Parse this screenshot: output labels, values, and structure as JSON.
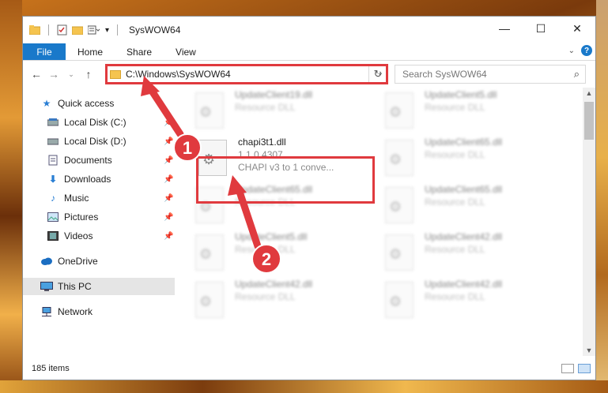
{
  "window": {
    "title": "SysWOW64",
    "controls": {
      "minimize": "—",
      "maximize": "☐",
      "close": "✕"
    }
  },
  "ribbon": {
    "tabs": [
      {
        "label": "File"
      },
      {
        "label": "Home"
      },
      {
        "label": "Share"
      },
      {
        "label": "View"
      }
    ],
    "help": "?"
  },
  "address": {
    "path": "C:\\Windows\\SysWOW64",
    "search_placeholder": "Search SysWOW64"
  },
  "sidebar": {
    "items": [
      {
        "label": "Quick access",
        "icon": "star-icon",
        "pinned": false
      },
      {
        "label": "Local Disk (C:)",
        "icon": "drive-icon",
        "pinned": true
      },
      {
        "label": "Local Disk (D:)",
        "icon": "drive-icon",
        "pinned": true
      },
      {
        "label": "Documents",
        "icon": "documents-icon",
        "pinned": true
      },
      {
        "label": "Downloads",
        "icon": "download-icon",
        "pinned": true
      },
      {
        "label": "Music",
        "icon": "music-icon",
        "pinned": true
      },
      {
        "label": "Pictures",
        "icon": "pictures-icon",
        "pinned": true
      },
      {
        "label": "Videos",
        "icon": "videos-icon",
        "pinned": true
      },
      {
        "label": "OneDrive",
        "icon": "cloud-icon",
        "pinned": false
      },
      {
        "label": "This PC",
        "icon": "computer-icon",
        "pinned": false,
        "selected": true
      },
      {
        "label": "Network",
        "icon": "network-icon",
        "pinned": false
      }
    ]
  },
  "files": {
    "left_column": [
      {
        "name": "UpdateClient19.dll",
        "line2": "Resource DLL",
        "blurred": true
      },
      {
        "name": "chapi3t1.dll",
        "line2": "1.1.0.4307",
        "line3": "CHAPI v3 to 1 conve...",
        "blurred": false
      },
      {
        "name": "UpdateClient65.dll",
        "line2": "Resource DLL",
        "blurred": true
      },
      {
        "name": "UpdateClient5.dll",
        "line2": "Resource DLL",
        "blurred": true
      },
      {
        "name": "UpdateClient42.dll",
        "line2": "Resource DLL",
        "blurred": true
      }
    ],
    "right_column": [
      {
        "name": "UpdateClient5.dll",
        "line2": "Resource DLL",
        "blurred": true
      },
      {
        "name": "UpdateClient65.dll",
        "line2": "Resource DLL",
        "blurred": true
      },
      {
        "name": "UpdateClient65.dll",
        "line2": "Resource DLL",
        "blurred": true
      },
      {
        "name": "UpdateClient42.dll",
        "line2": "Resource DLL",
        "blurred": true
      },
      {
        "name": "UpdateClient42.dll",
        "line2": "Resource DLL",
        "blurred": true
      }
    ]
  },
  "status": {
    "item_count": "185 items"
  },
  "annotations": {
    "marker1": "1",
    "marker2": "2",
    "color": "#e03a3e"
  }
}
